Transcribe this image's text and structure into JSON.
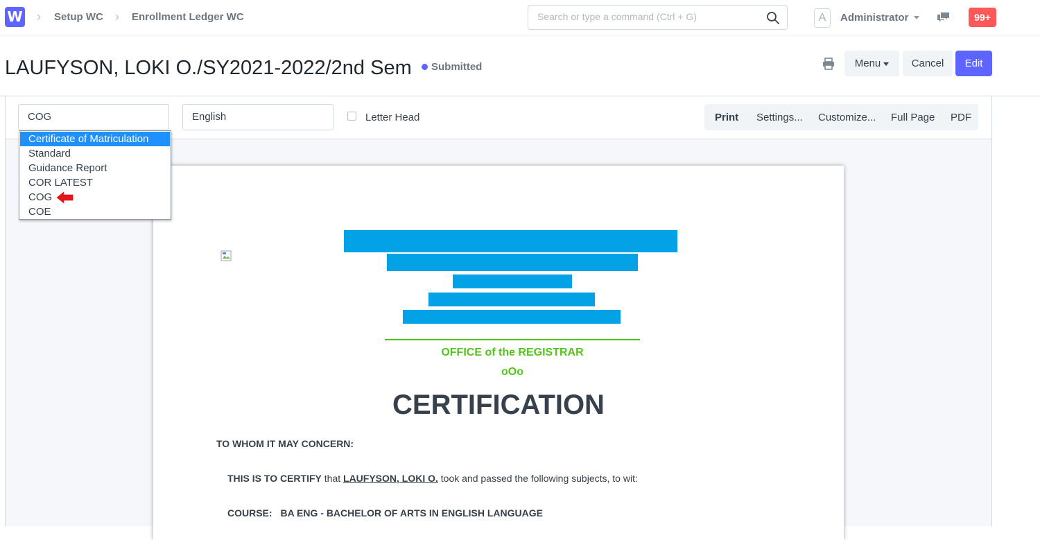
{
  "navbar": {
    "logo": "W",
    "breadcrumbs": [
      "Setup WC",
      "Enrollment Ledger WC"
    ],
    "search_placeholder": "Search or type a command (Ctrl + G)",
    "avatar_letter": "A",
    "user_name": "Administrator",
    "notification_count": "99+"
  },
  "page": {
    "title": "LAUFYSON, LOKI O./SY2021-2022/2nd Sem",
    "status": "Submitted",
    "buttons": {
      "menu": "Menu",
      "cancel": "Cancel",
      "edit": "Edit"
    }
  },
  "toolbar": {
    "print_format": "COG",
    "language": "English",
    "letter_head_label": "Letter Head",
    "letter_head_checked": false,
    "actions": [
      "Print",
      "Settings...",
      "Customize...",
      "Full Page",
      "PDF"
    ]
  },
  "format_dropdown": {
    "options": [
      "Certificate of Matriculation",
      "Standard",
      "Guidance Report",
      "COR LATEST",
      "COG",
      "COE"
    ],
    "highlighted": "Certificate of Matriculation",
    "pointed": "COG"
  },
  "document": {
    "office": "OFFICE of the REGISTRAR",
    "separator": "oOo",
    "title": "CERTIFICATION",
    "salutation": "TO WHOM IT MAY CONCERN:",
    "certify_prefix": "THIS IS TO CERTIFY",
    "certify_that": " that ",
    "student_name": "LAUFYSON, LOKI O.",
    "certify_suffix": " took and passed the following subjects, to wit:",
    "course_label": "COURSE:",
    "course_value": "BA ENG - BACHELOR OF ARTS IN ENGLISH LANGUAGE"
  },
  "colors": {
    "primary": "#5e64ff",
    "notification": "#ff5858",
    "redaction": "#03a2e6",
    "office_green": "#52c41a",
    "dropdown_highlight": "#1e90ff"
  }
}
